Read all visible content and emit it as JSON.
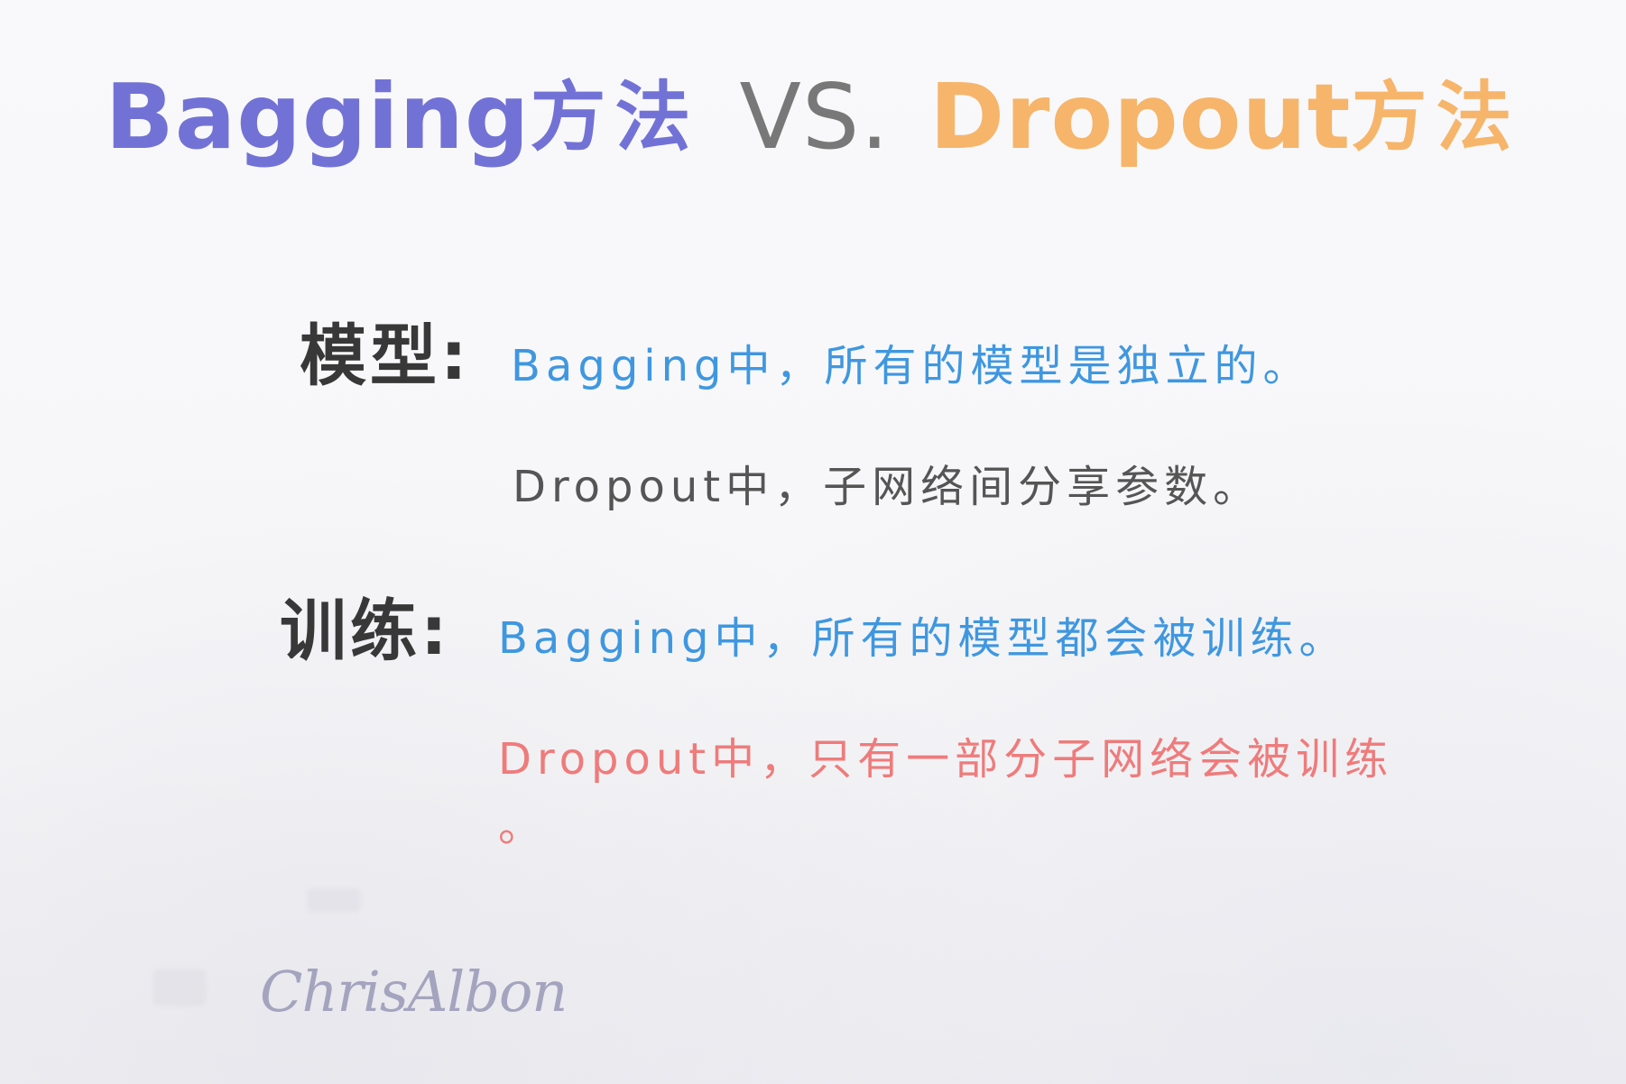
{
  "title": {
    "bagging": "Bagging",
    "bagging_cn": "方法",
    "vs": "VS.",
    "dropout": "Dropout",
    "dropout_cn": "方法"
  },
  "colors": {
    "bagging_title": "#7272d6",
    "dropout_title": "#f6b56b",
    "vs": "#787878",
    "label": "#383838",
    "blue_text": "#3f97e0",
    "gray_text": "#555555",
    "red_text": "#ef7b7b",
    "signature": "#a4a4bf",
    "background": "#f7f7f9"
  },
  "sections": {
    "model": {
      "label": "模型:",
      "bagging_line": "Bagging中，所有的模型是独立的。",
      "dropout_line": "Dropout中，子网络间分享参数。"
    },
    "training": {
      "label": "训练:",
      "bagging_line": "Bagging中，所有的模型都会被训练。",
      "dropout_line": "Dropout中，只有一部分子网络会被训练",
      "dropout_line_end": "。"
    }
  },
  "signature": "ChrisAlbon"
}
